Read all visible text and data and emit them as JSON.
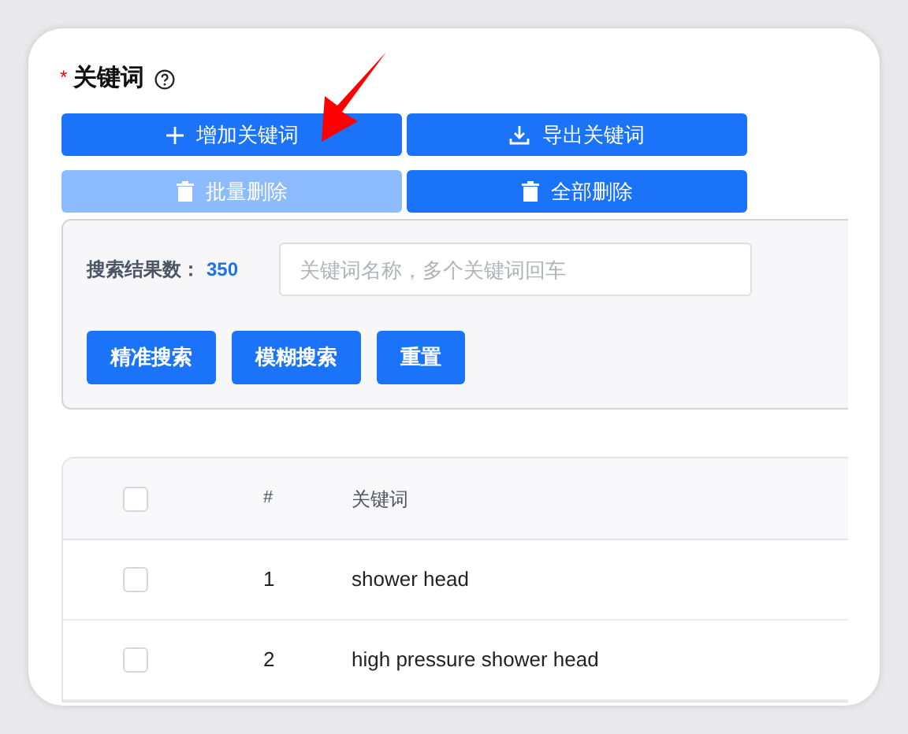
{
  "field": {
    "required_mark": "*",
    "label": "关键词"
  },
  "actions": [
    {
      "label": "增加关键词",
      "kind": "add",
      "disabled": false
    },
    {
      "label": "导出关键词",
      "kind": "export",
      "disabled": false
    },
    {
      "label": "批量删除",
      "kind": "delete",
      "disabled": true
    },
    {
      "label": "全部删除",
      "kind": "delete",
      "disabled": false
    }
  ],
  "search": {
    "result_label": "搜索结果数：",
    "result_count": "350",
    "placeholder": "关键词名称，多个关键词回车",
    "buttons": [
      "精准搜索",
      "模糊搜索",
      "重置"
    ]
  },
  "table": {
    "columns": [
      "#",
      "关键词"
    ],
    "header_checked": false,
    "rows": [
      {
        "index": "1",
        "keyword": "shower head",
        "checked": false
      },
      {
        "index": "2",
        "keyword": "high pressure shower head",
        "checked": false
      }
    ]
  }
}
